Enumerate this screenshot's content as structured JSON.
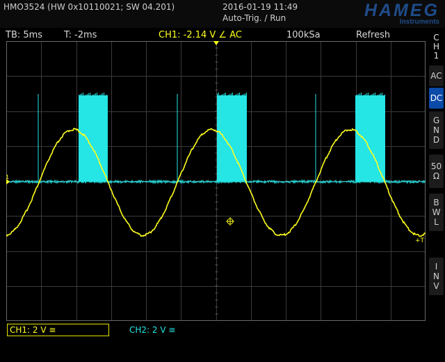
{
  "header": {
    "device_info": "HMO3524 (HW 0x10110021; SW 04.201)",
    "datetime": "2016-01-19 11:49",
    "trigger_mode": "Auto-Trig. / Run",
    "logo_main": "HAMEG",
    "logo_sub": "Instruments"
  },
  "settings": {
    "timebase": "TB: 5ms",
    "trigger_time": "T: -2ms",
    "ch1_trigger": "CH1: -2.14 V ∠ AC",
    "sample_rate": "100kSa",
    "acquisition_mode": "Refresh"
  },
  "side_menu": {
    "channel_chars": [
      "C",
      "H",
      "1"
    ],
    "buttons": [
      {
        "id": "ac",
        "chars": [
          "AC"
        ],
        "active": false
      },
      {
        "id": "dc",
        "chars": [
          "DC"
        ],
        "active": true
      },
      {
        "id": "gnd",
        "chars": [
          "G",
          "N",
          "D"
        ],
        "active": false
      },
      {
        "id": "ohm50",
        "chars": [
          "50",
          "Ω"
        ],
        "active": false
      },
      {
        "id": "bwl",
        "chars": [
          "B",
          "W",
          "L"
        ],
        "active": false
      },
      {
        "id": "inv",
        "chars": [
          "I",
          "N",
          "V"
        ],
        "active": false
      }
    ]
  },
  "channels": {
    "ch1_scale": "CH1: 2 V ≅",
    "ch2_scale": "CH2: 2 V ≅"
  },
  "markers": {
    "ground_marker": "1",
    "trigger_level_marker": "+T"
  },
  "colors": {
    "ch1": "#ffff1e",
    "ch2": "#25e5e5",
    "grid": "#3a3a3a",
    "active_button": "#0b4aa8",
    "logo": "#1f4c8a"
  }
}
